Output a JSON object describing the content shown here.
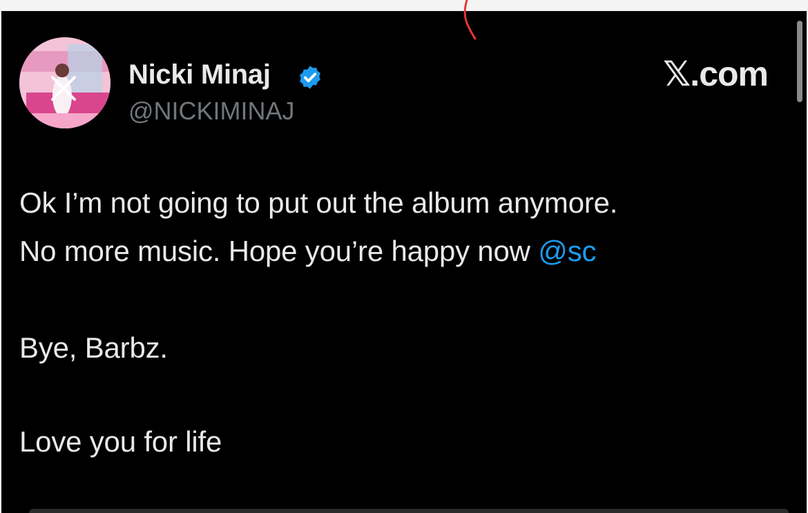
{
  "site": {
    "brand": "𝕏.com"
  },
  "profile": {
    "display_name": "Nicki Minaj",
    "handle": "@NICKIMINAJ",
    "verified": true,
    "verified_color": "#1d9bf0"
  },
  "tweet": {
    "line1": "Ok I’m not going to put out the album anymore.",
    "line2_text": "No more music. Hope you’re happy now ",
    "line2_mention": "@sc",
    "line3": "Bye, Barbz.",
    "line4": "Love you for life"
  },
  "icons": {
    "close": "close-icon",
    "verified": "verified-badge-icon"
  },
  "colors": {
    "background": "#000000",
    "text": "#e7e9ea",
    "secondary_text": "#71767b",
    "link": "#1d9bf0"
  }
}
